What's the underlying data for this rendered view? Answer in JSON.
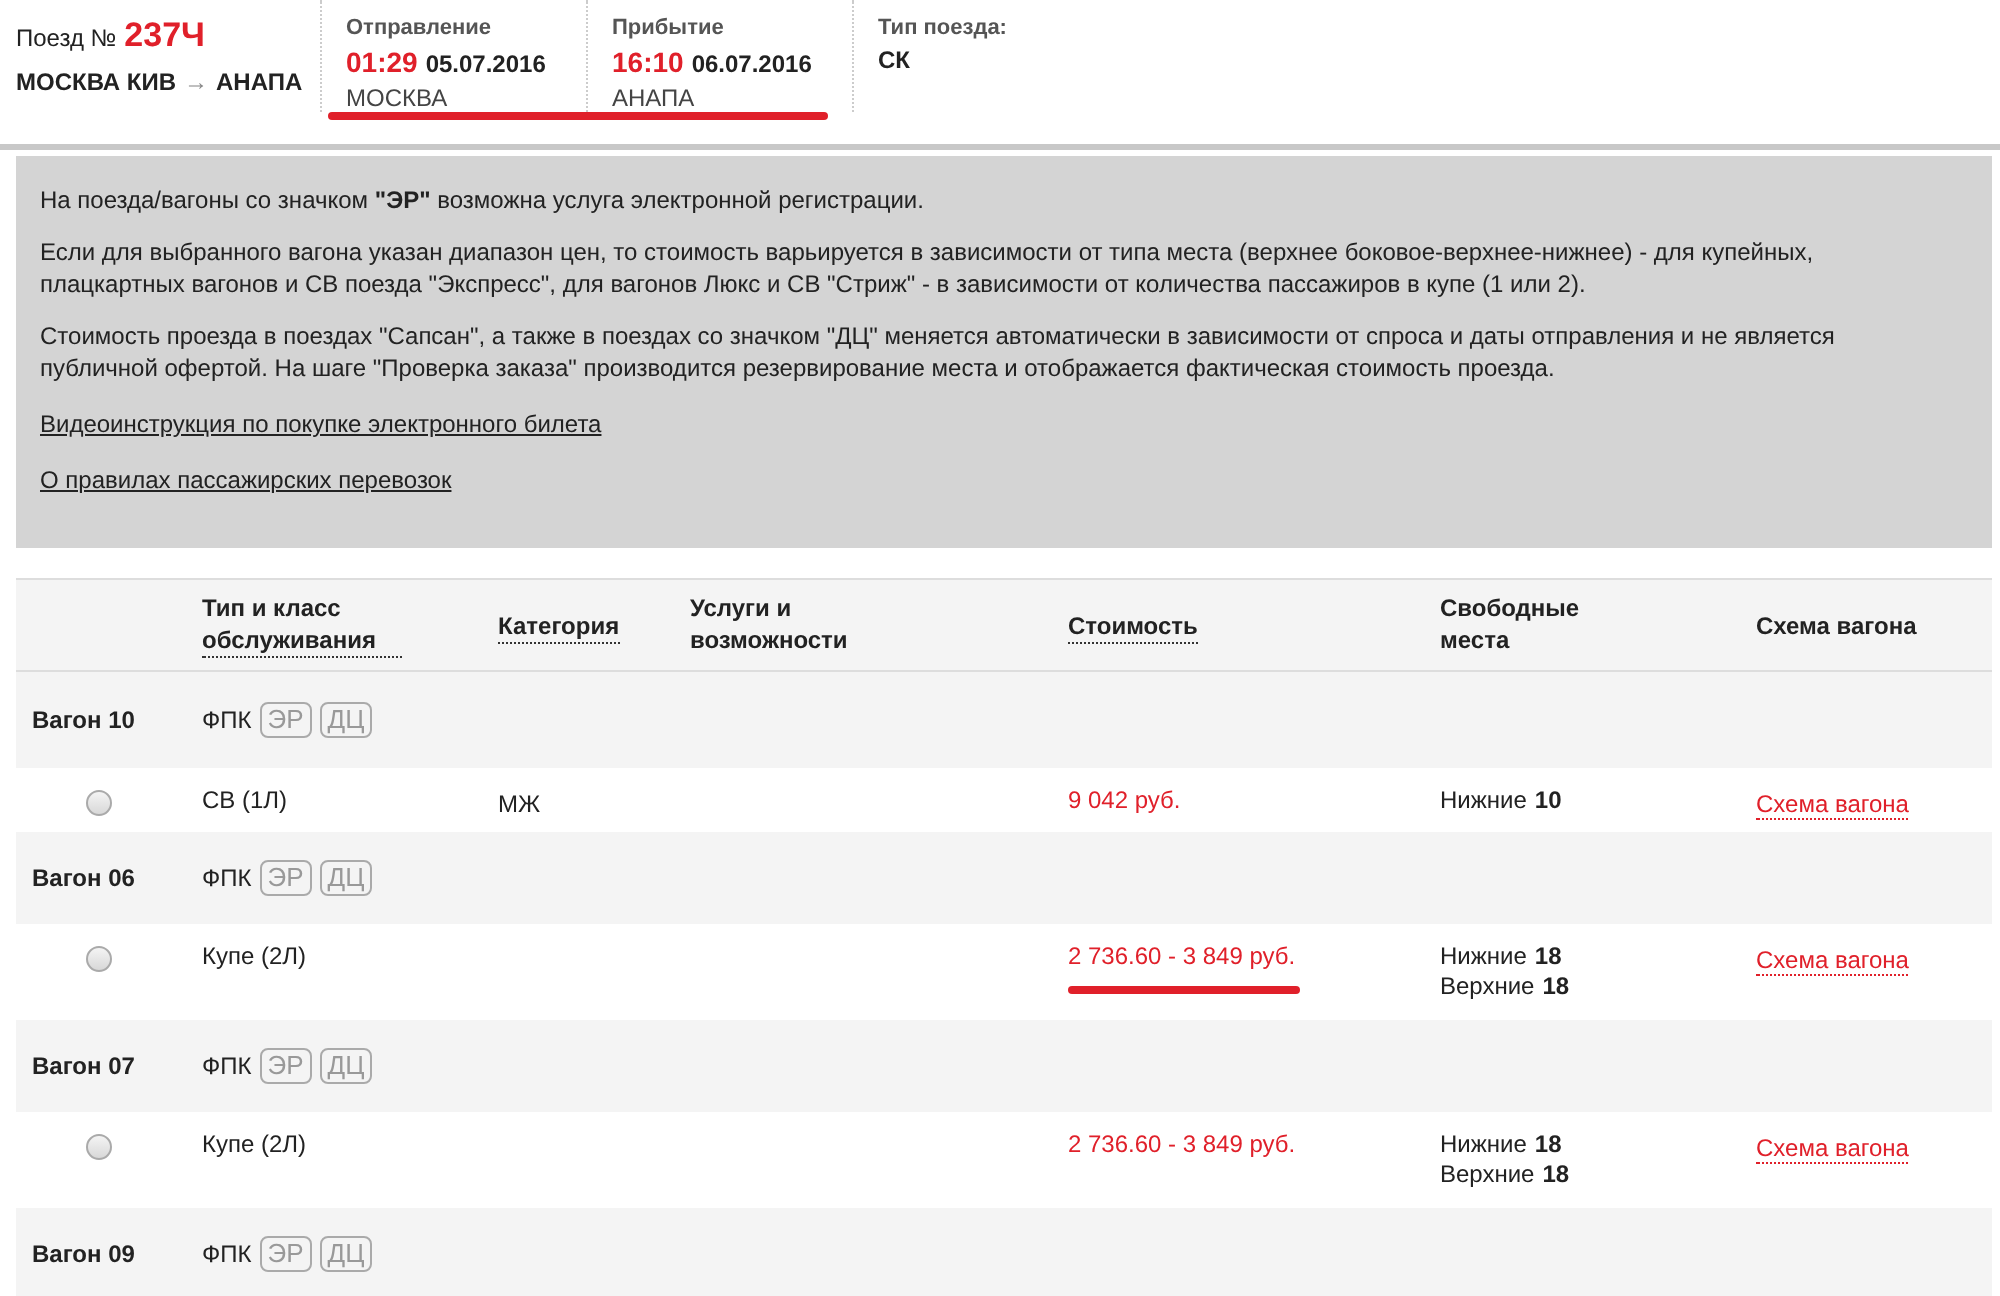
{
  "train": {
    "number_label": "Поезд №",
    "number": "237Ч",
    "from": "МОСКВА КИВ",
    "arrow": "→",
    "to": "АНАПА"
  },
  "schedule": [
    {
      "label": "Отправление",
      "time": "01:29",
      "date": "05.07.2016",
      "station": "МОСКВА"
    },
    {
      "label": "Прибытие",
      "time": "16:10",
      "date": "06.07.2016",
      "station": "АНАПА"
    }
  ],
  "schedule_highlighted": true,
  "train_type": {
    "label": "Тип поезда:",
    "value": "СК"
  },
  "info": {
    "paragraphs": [
      "На поезда/вагоны со значком **\"ЭР\"** возможна услуга электронной регистрации.",
      "Если для выбранного вагона указан диапазон цен, то стоимость варьируется в зависимости от типа места (верхнее боковое-верхнее-нижнее) - для купейных, плацкартных вагонов и СВ поезда \"Экспресс\", для вагонов Люкс и СВ \"Стриж\" - в зависимости от количества пассажиров в купе (1 или 2).",
      "Стоимость проезда в поездах \"Сапсан\", а также в поездах со значком \"ДЦ\" меняется автоматически в зависимости от спроса и даты отправления и не является публичной офертой. На шаге \"Проверка заказа\" производится резервирование места и отображается фактическая стоимость проезда."
    ],
    "links": [
      "Видеоинструкция по покупке электронного билета",
      "О правилах пассажирских перевозок"
    ]
  },
  "table": {
    "columns": [
      {
        "label": "Тип и класс обслуживания",
        "sortable": true
      },
      {
        "label": "Категория",
        "sortable": true
      },
      {
        "label": "Услуги и возможности",
        "sortable": false
      },
      {
        "label": "Стоимость",
        "sortable": true
      },
      {
        "label": "Свободные места",
        "sortable": false
      },
      {
        "label": "Схема вагона",
        "sortable": false
      }
    ],
    "wagons": [
      {
        "name": "Вагон 10",
        "carrier": "ФПК",
        "badges": [
          "ЭР",
          "ДЦ"
        ],
        "seats": [
          {
            "selected": false,
            "type": "СВ (1Л)",
            "category": "МЖ",
            "price": "9 042 руб.",
            "price_highlighted": false,
            "places": [
              {
                "label": "Нижние",
                "count": "10"
              }
            ],
            "scheme": "Схема вагона"
          }
        ]
      },
      {
        "name": "Вагон 06",
        "carrier": "ФПК",
        "badges": [
          "ЭР",
          "ДЦ"
        ],
        "seats": [
          {
            "selected": false,
            "type": "Купе (2Л)",
            "price": "2 736.60 - 3 849 руб.",
            "price_highlighted": true,
            "places": [
              {
                "label": "Нижние",
                "count": "18"
              },
              {
                "label": "Верхние",
                "count": "18"
              }
            ],
            "scheme": "Схема вагона"
          }
        ]
      },
      {
        "name": "Вагон 07",
        "carrier": "ФПК",
        "badges": [
          "ЭР",
          "ДЦ"
        ],
        "seats": [
          {
            "selected": false,
            "type": "Купе (2Л)",
            "price": "2 736.60 - 3 849 руб.",
            "price_highlighted": false,
            "places": [
              {
                "label": "Нижние",
                "count": "18"
              },
              {
                "label": "Верхние",
                "count": "18"
              }
            ],
            "scheme": "Схема вагона"
          }
        ]
      },
      {
        "name": "Вагон 09",
        "carrier": "ФПК",
        "badges": [
          "ЭР",
          "ДЦ"
        ]
      }
    ]
  }
}
